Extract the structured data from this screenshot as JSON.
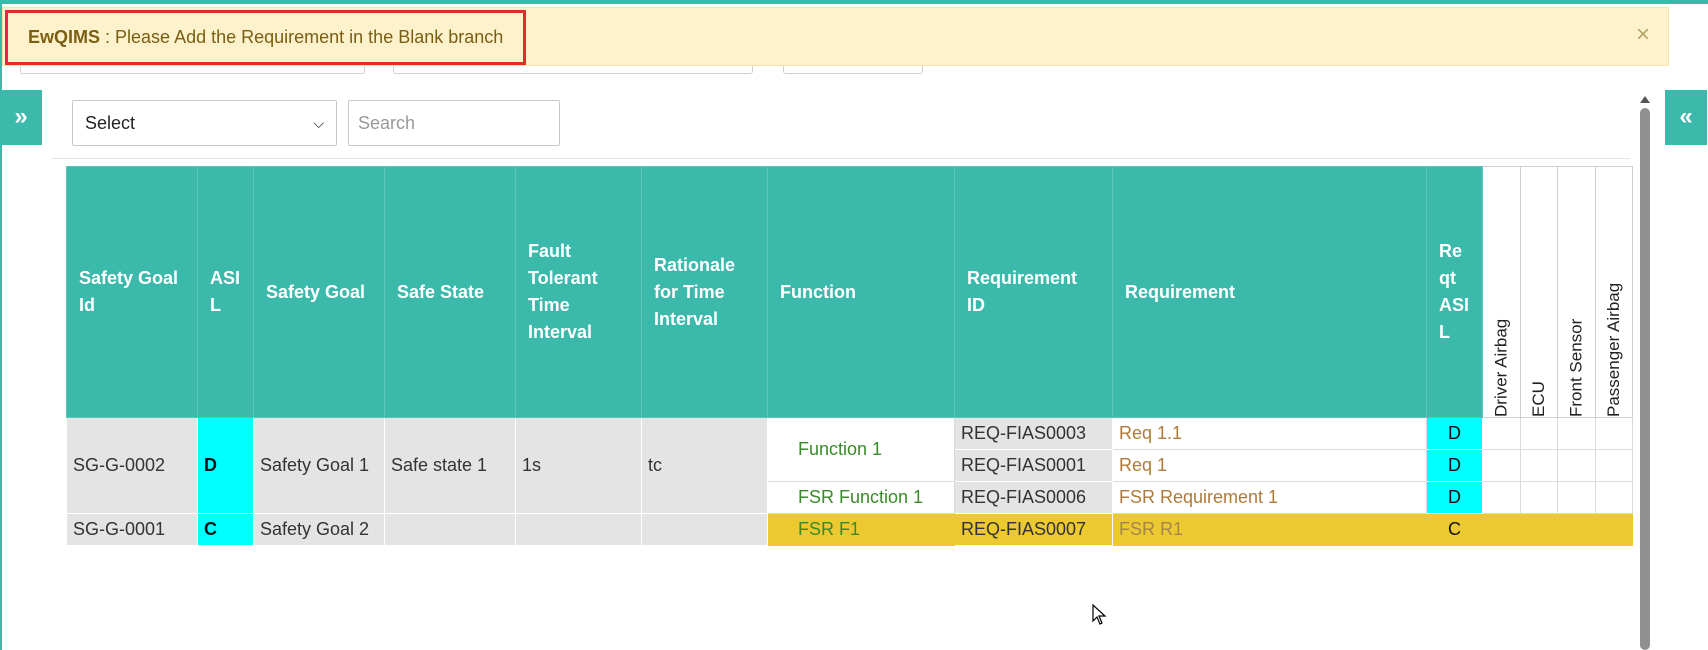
{
  "alert": {
    "brand": "EwQIMS",
    "message": " : Please Add the Requirement in the Blank branch",
    "close": "×"
  },
  "toggles": {
    "left": "»",
    "right": "«"
  },
  "filters": {
    "select_value": "Select",
    "search_placeholder": "Search"
  },
  "table": {
    "headers": [
      "Safety Goal Id",
      "ASIL",
      "Safety Goal",
      "Safe State",
      "Fault Tolerant Time Interval",
      "Rationale for Time Interval",
      "Function",
      "Requirement ID",
      "Requirement",
      "Reqt ASIL"
    ],
    "vertical_headers": [
      "Driver Airbag",
      "ECU",
      "Front Sensor",
      "Passenger Airbag"
    ],
    "goals": [
      {
        "id": "SG-G-0002",
        "asil": "D",
        "goal": "Safety Goal 1",
        "safe_state": "Safe state 1",
        "ftti": "1s",
        "rationale": "tc",
        "functions": [
          {
            "name": "Function 1",
            "requirements": [
              {
                "id": "REQ-FIAS0003",
                "text": "Req 1.1",
                "asil": "D"
              },
              {
                "id": "REQ-FIAS0001",
                "text": "Req 1",
                "asil": "D"
              }
            ]
          },
          {
            "name": "FSR Function 1",
            "requirements": [
              {
                "id": "REQ-FIAS0006",
                "text": "FSR Requirement 1",
                "asil": "D"
              }
            ]
          }
        ]
      },
      {
        "id": "SG-G-0001",
        "asil": "C",
        "goal": "Safety Goal 2",
        "safe_state": "",
        "ftti": "",
        "rationale": "",
        "functions": [
          {
            "name": "FSR F1",
            "requirements": [
              {
                "id": "REQ-FIAS0007",
                "text": "FSR R1",
                "asil": "C"
              }
            ]
          }
        ]
      }
    ]
  },
  "icons": {
    "close": "close-icon",
    "expand_left": "double-chevron-right-icon",
    "collapse_right": "double-chevron-left-icon",
    "select_caret": "chevron-down-icon"
  },
  "colors": {
    "accent": "#3bb9ab",
    "alert_bg": "#fdf2cc",
    "alert_border": "#e32b2b",
    "asil_cell": "#00ffff",
    "highlight_row": "#ecc930",
    "grey_cell": "#e4e4e4"
  }
}
